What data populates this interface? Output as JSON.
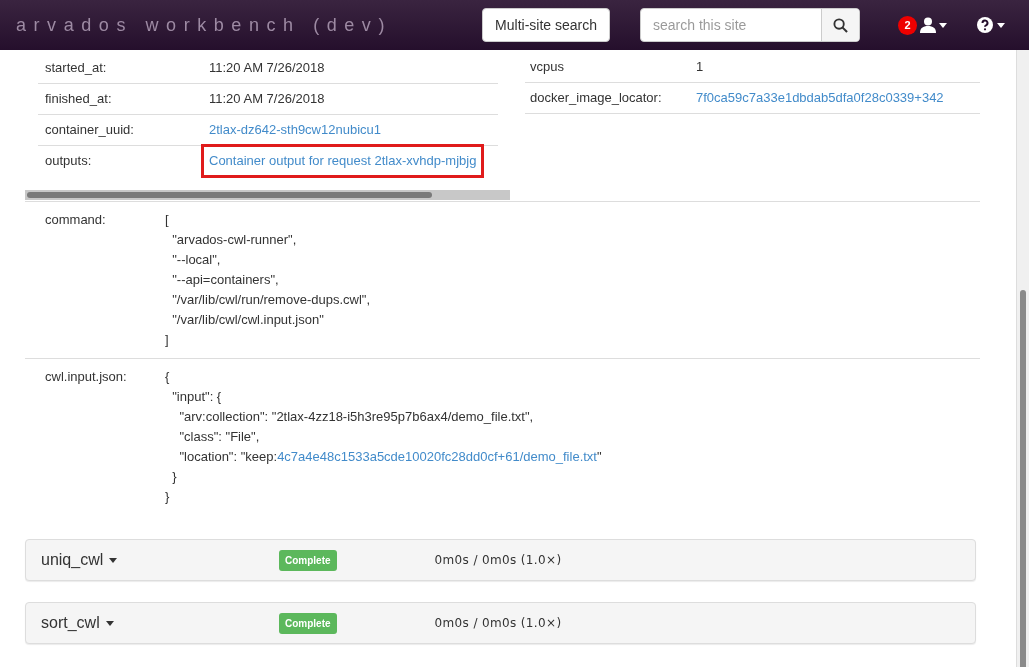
{
  "navbar": {
    "brand": "arvados workbench (dev)",
    "multi_site_button": "Multi-site search",
    "search": {
      "placeholder": "search this site"
    },
    "notification_count": "2"
  },
  "details_left": [
    {
      "label": "started_at:",
      "value": "11:20 AM 7/26/2018",
      "kind": "text",
      "highlighted": false
    },
    {
      "label": "finished_at:",
      "value": "11:20 AM 7/26/2018",
      "kind": "text",
      "highlighted": false
    },
    {
      "label": "container_uuid:",
      "value": "2tlax-dz642-sth9cw12nubicu1",
      "kind": "link",
      "highlighted": false
    },
    {
      "label": "outputs:",
      "value": "Container output for request 2tlax-xvhdp-mjbjg",
      "kind": "link",
      "highlighted": true
    }
  ],
  "details_right": [
    {
      "label": "vcpus",
      "value": "1",
      "kind": "text"
    },
    {
      "label": "docker_image_locator:",
      "value": "7f0ca59c7a33e1dbdab5dfa0f28c0339+342",
      "kind": "link"
    }
  ],
  "command": {
    "label": "command:",
    "lines": [
      "[",
      "  \"arvados-cwl-runner\",",
      "  \"--local\",",
      "  \"--api=containers\",",
      "  \"/var/lib/cwl/run/remove-dups.cwl\",",
      "  \"/var/lib/cwl/cwl.input.json\"",
      "]"
    ]
  },
  "cwl_input": {
    "label": "cwl.input.json:",
    "lines": [
      [
        {
          "text": "{",
          "kind": "plain"
        }
      ],
      [
        {
          "text": "  \"input\": {",
          "kind": "plain"
        }
      ],
      [
        {
          "text": "    \"arv:collection\": \"2tlax-4zz18-i5h3re95p7b6ax4/demo_file.txt\",",
          "kind": "plain"
        }
      ],
      [
        {
          "text": "    \"class\": \"File\",",
          "kind": "plain"
        }
      ],
      [
        {
          "text": "    \"location\": \"keep:",
          "kind": "plain"
        },
        {
          "text": "4c7a4e48c1533a5cde10020fc28dd0cf+61/demo_file.txt",
          "kind": "link"
        },
        {
          "text": "\"",
          "kind": "plain"
        }
      ],
      [
        {
          "text": "  }",
          "kind": "plain"
        }
      ],
      [
        {
          "text": "}",
          "kind": "plain"
        }
      ]
    ]
  },
  "steps": [
    {
      "name": "uniq_cwl",
      "status": "Complete",
      "timing": "0m0s / 0m0s (1.0×)"
    },
    {
      "name": "sort_cwl",
      "status": "Complete",
      "timing": "0m0s / 0m0s (1.0×)"
    }
  ]
}
